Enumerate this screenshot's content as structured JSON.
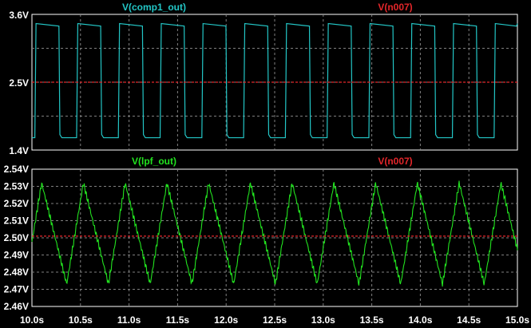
{
  "colors": {
    "background": "#000000",
    "frame": "#ffffff",
    "grid": "#808080",
    "tick_text": "#ffffff",
    "comp1_trace": "#23c6c6",
    "lpf_trace": "#22e31f",
    "n007_trace": "#e3262a"
  },
  "panes": [
    {
      "traces": [
        {
          "name": "V(comp1_out)",
          "color_key": "comp1_trace"
        },
        {
          "name": "V(n007)",
          "color_key": "n007_trace"
        }
      ],
      "y_ticks": [
        "3.6V",
        "2.5V",
        "1.4V"
      ]
    },
    {
      "traces": [
        {
          "name": "V(lpf_out)",
          "color_key": "lpf_trace"
        },
        {
          "name": "V(n007)",
          "color_key": "n007_trace"
        }
      ],
      "y_ticks": [
        "2.54V",
        "2.53V",
        "2.52V",
        "2.51V",
        "2.50V",
        "2.49V",
        "2.48V",
        "2.47V",
        "2.46V"
      ]
    }
  ],
  "x_ticks": [
    "10.0s",
    "10.5s",
    "11.0s",
    "11.5s",
    "12.0s",
    "12.5s",
    "13.0s",
    "13.5s",
    "14.0s",
    "14.5s",
    "15.0s"
  ],
  "chart_data": [
    {
      "type": "line",
      "x_range": [
        10.0,
        15.0
      ],
      "ylim": [
        1.4,
        3.6
      ],
      "grid": true,
      "series": [
        {
          "name": "V(comp1_out)",
          "kind": "square_wave",
          "period": 0.43,
          "start": 10.0,
          "duty": 0.6,
          "high": 3.45,
          "low": 1.6
        },
        {
          "name": "V(n007)",
          "values_constant": 2.5
        }
      ]
    },
    {
      "type": "line",
      "x_range": [
        10.0,
        15.0
      ],
      "ylim": [
        2.46,
        2.54
      ],
      "grid": true,
      "series": [
        {
          "name": "V(lpf_out)",
          "kind": "triangle_ripple",
          "period": 0.43,
          "peak_x_first": 10.1,
          "max": 2.532,
          "min": 2.473
        },
        {
          "name": "V(n007)",
          "values_constant": 2.501
        }
      ]
    }
  ]
}
